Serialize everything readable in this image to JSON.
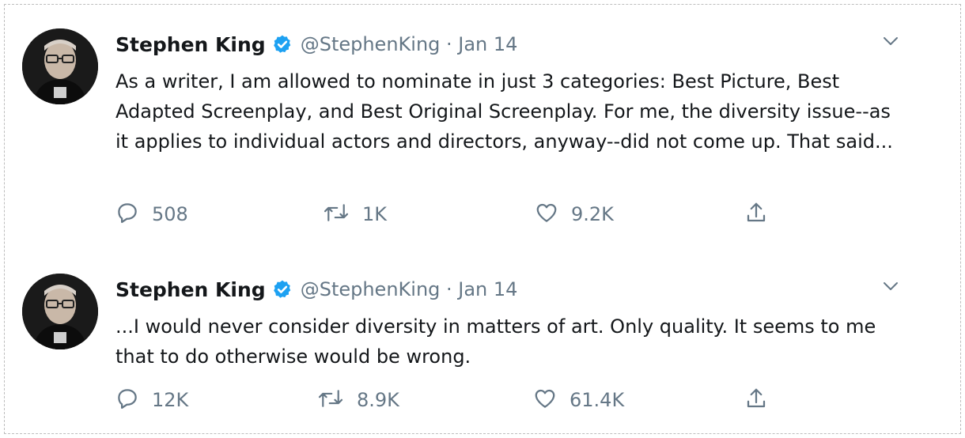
{
  "tweets": [
    {
      "name": "Stephen King",
      "handle_date": "@StephenKing · Jan 14",
      "text": "As a writer, I am allowed to nominate in just 3 categories: Best Picture, Best Adapted Screenplay, and Best Original Screenplay. For me, the diversity issue--as it applies to individual actors and directors, anyway--did not come up. That said...",
      "replies": "508",
      "retweets": "1K",
      "likes": "9.2K"
    },
    {
      "name": "Stephen King",
      "handle_date": "@StephenKing · Jan 14",
      "text": "...I would never consider diversity in matters of art. Only quality. It seems to me that to do otherwise would be wrong.",
      "replies": "12K",
      "retweets": "8.9K",
      "likes": "61.4K"
    }
  ],
  "icons": {
    "verified": "verified-badge-icon",
    "more": "chevron-down-icon",
    "reply": "reply-icon",
    "retweet": "retweet-icon",
    "like": "heart-icon",
    "share": "share-icon"
  },
  "colors": {
    "verified_blue": "#1da1f2",
    "secondary_text": "#657786",
    "primary_text": "#14171a"
  }
}
